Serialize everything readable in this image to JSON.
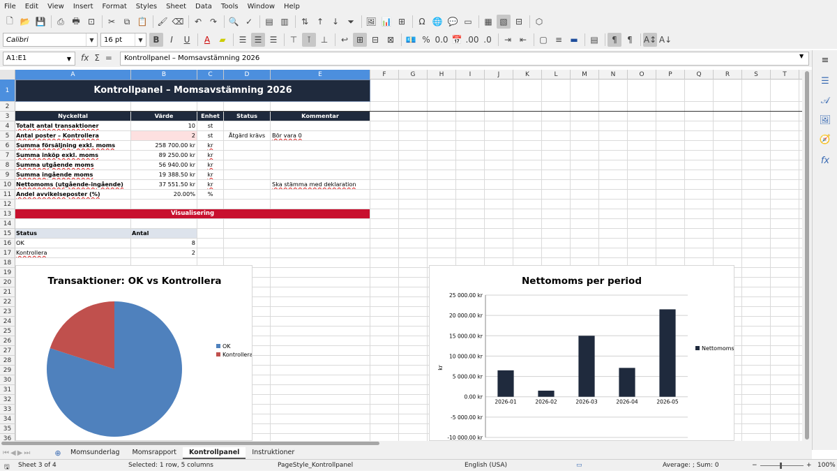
{
  "menu": [
    "File",
    "Edit",
    "View",
    "Insert",
    "Format",
    "Styles",
    "Sheet",
    "Data",
    "Tools",
    "Window",
    "Help"
  ],
  "toolbar": {
    "font_name": "Calibri",
    "font_size": "16 pt"
  },
  "formula_bar": {
    "name_box": "A1:E1",
    "fx": "fx",
    "sum": "Σ",
    "equals": "=",
    "content": "Kontrollpanel – Momsavstämning 2026"
  },
  "columns": [
    "A",
    "B",
    "C",
    "D",
    "E",
    "F",
    "G",
    "H",
    "I",
    "J",
    "K",
    "L",
    "M",
    "N",
    "O",
    "P",
    "Q",
    "R",
    "S",
    "T"
  ],
  "rows": [
    "1",
    "2",
    "3",
    "4",
    "5",
    "6",
    "7",
    "8",
    "9",
    "10",
    "11",
    "12",
    "13",
    "14",
    "15",
    "16",
    "17",
    "18",
    "19",
    "20",
    "21",
    "22",
    "23",
    "24",
    "25",
    "26",
    "27",
    "28",
    "29",
    "30",
    "31",
    "32",
    "33",
    "34",
    "35",
    "36"
  ],
  "sheet": {
    "title": "Kontrollpanel – Momsavstämning 2026",
    "headers": [
      "Nyckeltal",
      "Värde",
      "Enhet",
      "Status",
      "Kommentar"
    ],
    "kpis": [
      {
        "label": "Totalt antal transaktioner",
        "value": "10",
        "unit": "st",
        "status": "",
        "comment": ""
      },
      {
        "label": "Antal poster – Kontrollera",
        "value": "2",
        "unit": "st",
        "status": "Åtgärd krävs",
        "comment": "Bör vara 0"
      },
      {
        "label": "Summa försäljning exkl. moms",
        "value": "258 700.00 kr",
        "unit": "kr",
        "status": "",
        "comment": ""
      },
      {
        "label": "Summa inköp exkl. moms",
        "value": "89 250.00 kr",
        "unit": "kr",
        "status": "",
        "comment": ""
      },
      {
        "label": "Summa utgående moms",
        "value": "56 940.00 kr",
        "unit": "kr",
        "status": "",
        "comment": ""
      },
      {
        "label": "Summa ingående moms",
        "value": "19 388.50 kr",
        "unit": "kr",
        "status": "",
        "comment": ""
      },
      {
        "label": "Nettomoms (utgående-ingående)",
        "value": "37 551.50 kr",
        "unit": "kr",
        "status": "",
        "comment": "Ska stämma med deklaration"
      },
      {
        "label": "Andel avvikelseposter (%)",
        "value": "20.00%",
        "unit": "%",
        "status": "",
        "comment": ""
      }
    ],
    "viz_label": "Visualisering",
    "status_table": {
      "headers": [
        "Status",
        "Antal"
      ],
      "rows": [
        [
          "OK",
          "8"
        ],
        [
          "Kontrollera",
          "2"
        ]
      ]
    }
  },
  "chart_data": [
    {
      "type": "pie",
      "title": "Transaktioner: OK vs Kontrollera",
      "categories": [
        "OK",
        "Kontrollera"
      ],
      "values": [
        8,
        2
      ],
      "colors": [
        "#4f81bd",
        "#c0504d"
      ],
      "legend": "right"
    },
    {
      "type": "bar",
      "title": "Nettomoms per period",
      "categories": [
        "2026-01",
        "2026-02",
        "2026-03",
        "2026-04",
        "2026-05"
      ],
      "series": [
        {
          "name": "Nettomoms",
          "values": [
            6500,
            1500,
            15000,
            7100,
            21500
          ]
        }
      ],
      "ylabel": "kr",
      "ylim": [
        -10000,
        25000
      ],
      "yticks": [
        25000,
        20000,
        15000,
        10000,
        5000,
        0,
        -5000,
        -10000
      ],
      "ytick_labels": [
        "25 000.00 kr",
        "20 000.00 kr",
        "15 000.00 kr",
        "10 000.00 kr",
        "5 000.00 kr",
        "0.00 kr",
        "-5 000.00 kr",
        "-10 000.00 kr"
      ],
      "color": "#1f2a3d",
      "grid": true,
      "legend": "right"
    }
  ],
  "tabs": [
    {
      "label": "Momsunderlag",
      "active": false
    },
    {
      "label": "Momsrapport",
      "active": false
    },
    {
      "label": "Kontrollpanel",
      "active": true
    },
    {
      "label": "Instruktioner",
      "active": false
    }
  ],
  "status_bar": {
    "sheet": "Sheet 3 of 4",
    "selection": "Selected: 1 row, 5 columns",
    "page_style": "PageStyle_Kontrollpanel",
    "language": "English (USA)",
    "summary": "Average: ; Sum: 0",
    "zoom": "100%"
  },
  "colors": {
    "header_bg": "#1f2a3d",
    "viz_red": "#c8102e",
    "selection_blue": "#4c8fde",
    "flag_pink": "#fde0e0"
  }
}
